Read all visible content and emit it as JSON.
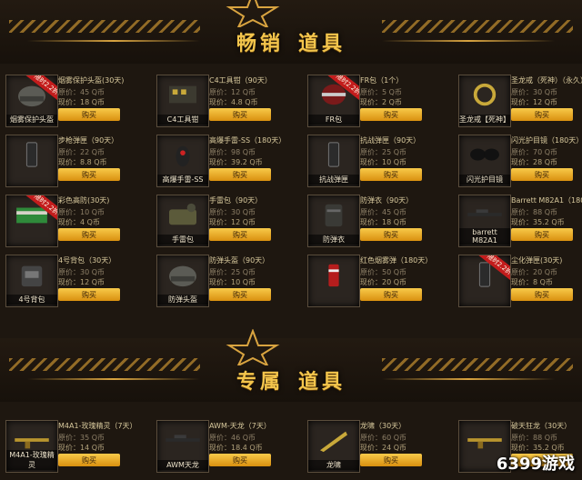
{
  "banner_top": {
    "left": "畅销",
    "right": "道具"
  },
  "banner_bottom": {
    "left": "专属",
    "right": "道具"
  },
  "buy_label": "购买",
  "items_top": [
    {
      "name": "烟雾保护头盔(30天)",
      "orig": "原价：45 Q币",
      "now": "现价：18 Q币",
      "cap": "烟雾保护头盔",
      "badge": "限时2.2折",
      "icon": "helmet-icon"
    },
    {
      "name": "C4工具钳（90天）",
      "orig": "原价：12 Q币",
      "now": "现价：4.8 Q币",
      "cap": "C4工具钳",
      "badge": "",
      "icon": "pliers-icon"
    },
    {
      "name": "FR包（1个）",
      "orig": "原价：5 Q币",
      "now": "现价：2 Q币",
      "cap": "FR包",
      "badge": "限时2.2折",
      "icon": "bag-icon"
    },
    {
      "name": "圣龙戒（死神）（永久）",
      "orig": "原价：30 Q币",
      "now": "现价：12 Q币",
      "cap": "圣龙戒【死神】",
      "badge": "",
      "icon": "ring-icon"
    },
    {
      "name": "步枪弹匣（90天）",
      "orig": "原价：22 Q币",
      "now": "现价：8.8 Q币",
      "cap": "",
      "badge": "",
      "icon": "magazine-icon"
    },
    {
      "name": "高爆手雷-SS（180天）",
      "orig": "原价：98 Q币",
      "now": "现价：39.2 Q币",
      "cap": "高爆手雷-SS",
      "badge": "",
      "icon": "grenade-icon"
    },
    {
      "name": "抗战弹匣（90天）",
      "orig": "原价：25 Q币",
      "now": "现价：10 Q币",
      "cap": "抗战弹匣",
      "badge": "",
      "icon": "magazine-icon"
    },
    {
      "name": "闪光护目镜（180天）",
      "orig": "原价：70 Q币",
      "now": "现价：28 Q币",
      "cap": "闪光护目镜",
      "badge": "",
      "icon": "goggles-icon"
    },
    {
      "name": "彩色高防(30天)",
      "orig": "原价：10 Q币",
      "now": "现价：4 Q币",
      "cap": "",
      "badge": "限时2.2折",
      "icon": "armor-icon"
    },
    {
      "name": "手雷包（90天）",
      "orig": "原价：30 Q币",
      "now": "现价：12 Q币",
      "cap": "手雷包",
      "badge": "",
      "icon": "grenade-bag-icon"
    },
    {
      "name": "防弹衣（90天）",
      "orig": "原价：45 Q币",
      "now": "现价：18 Q币",
      "cap": "防弹衣",
      "badge": "",
      "icon": "vest-icon"
    },
    {
      "name": "Barrett M82A1（180天）",
      "orig": "原价：88 Q币",
      "now": "现价：35.2 Q币",
      "cap": "barrett M82A1",
      "badge": "",
      "icon": "sniper-icon"
    },
    {
      "name": "4号背包（30天）",
      "orig": "原价：30 Q币",
      "now": "现价：12 Q币",
      "cap": "4号背包",
      "badge": "",
      "icon": "backpack-icon"
    },
    {
      "name": "防弹头盔（90天）",
      "orig": "原价：25 Q币",
      "now": "现价：10 Q币",
      "cap": "防弹头盔",
      "badge": "",
      "icon": "helmet-icon"
    },
    {
      "name": "红色烟雾弹（180天）",
      "orig": "原价：50 Q币",
      "now": "现价：20 Q币",
      "cap": "",
      "badge": "",
      "icon": "smoke-icon"
    },
    {
      "name": "尘化弹匣(30天)",
      "orig": "原价：20 Q币",
      "now": "现价：8 Q币",
      "cap": "",
      "badge": "限时2.2折",
      "icon": "magazine-icon"
    }
  ],
  "items_bottom": [
    {
      "name": "M4A1-玫瑰精灵（7天）",
      "orig": "原价：35 Q币",
      "now": "现价：14 Q币",
      "cap": "M4A1-玫瑰精灵",
      "badge": "",
      "icon": "rifle-icon"
    },
    {
      "name": "AWM-天龙（7天）",
      "orig": "原价：46 Q币",
      "now": "现价：18.4 Q币",
      "cap": "AWM天龙",
      "badge": "",
      "icon": "sniper-icon"
    },
    {
      "name": "龙啸（30天）",
      "orig": "原价：60 Q币",
      "now": "现价：24 Q币",
      "cap": "龙啸",
      "badge": "",
      "icon": "knife-icon"
    },
    {
      "name": "破天狂龙（30天）",
      "orig": "原价：88 Q币",
      "now": "现价：35.2 Q币",
      "cap": "",
      "badge": "",
      "icon": "rifle-icon"
    }
  ],
  "watermark": "6399游戏",
  "colors": {
    "accent": "#f3c54c",
    "button": "#e8a825",
    "badge": "#c31c1c",
    "background": "#1e1710"
  }
}
